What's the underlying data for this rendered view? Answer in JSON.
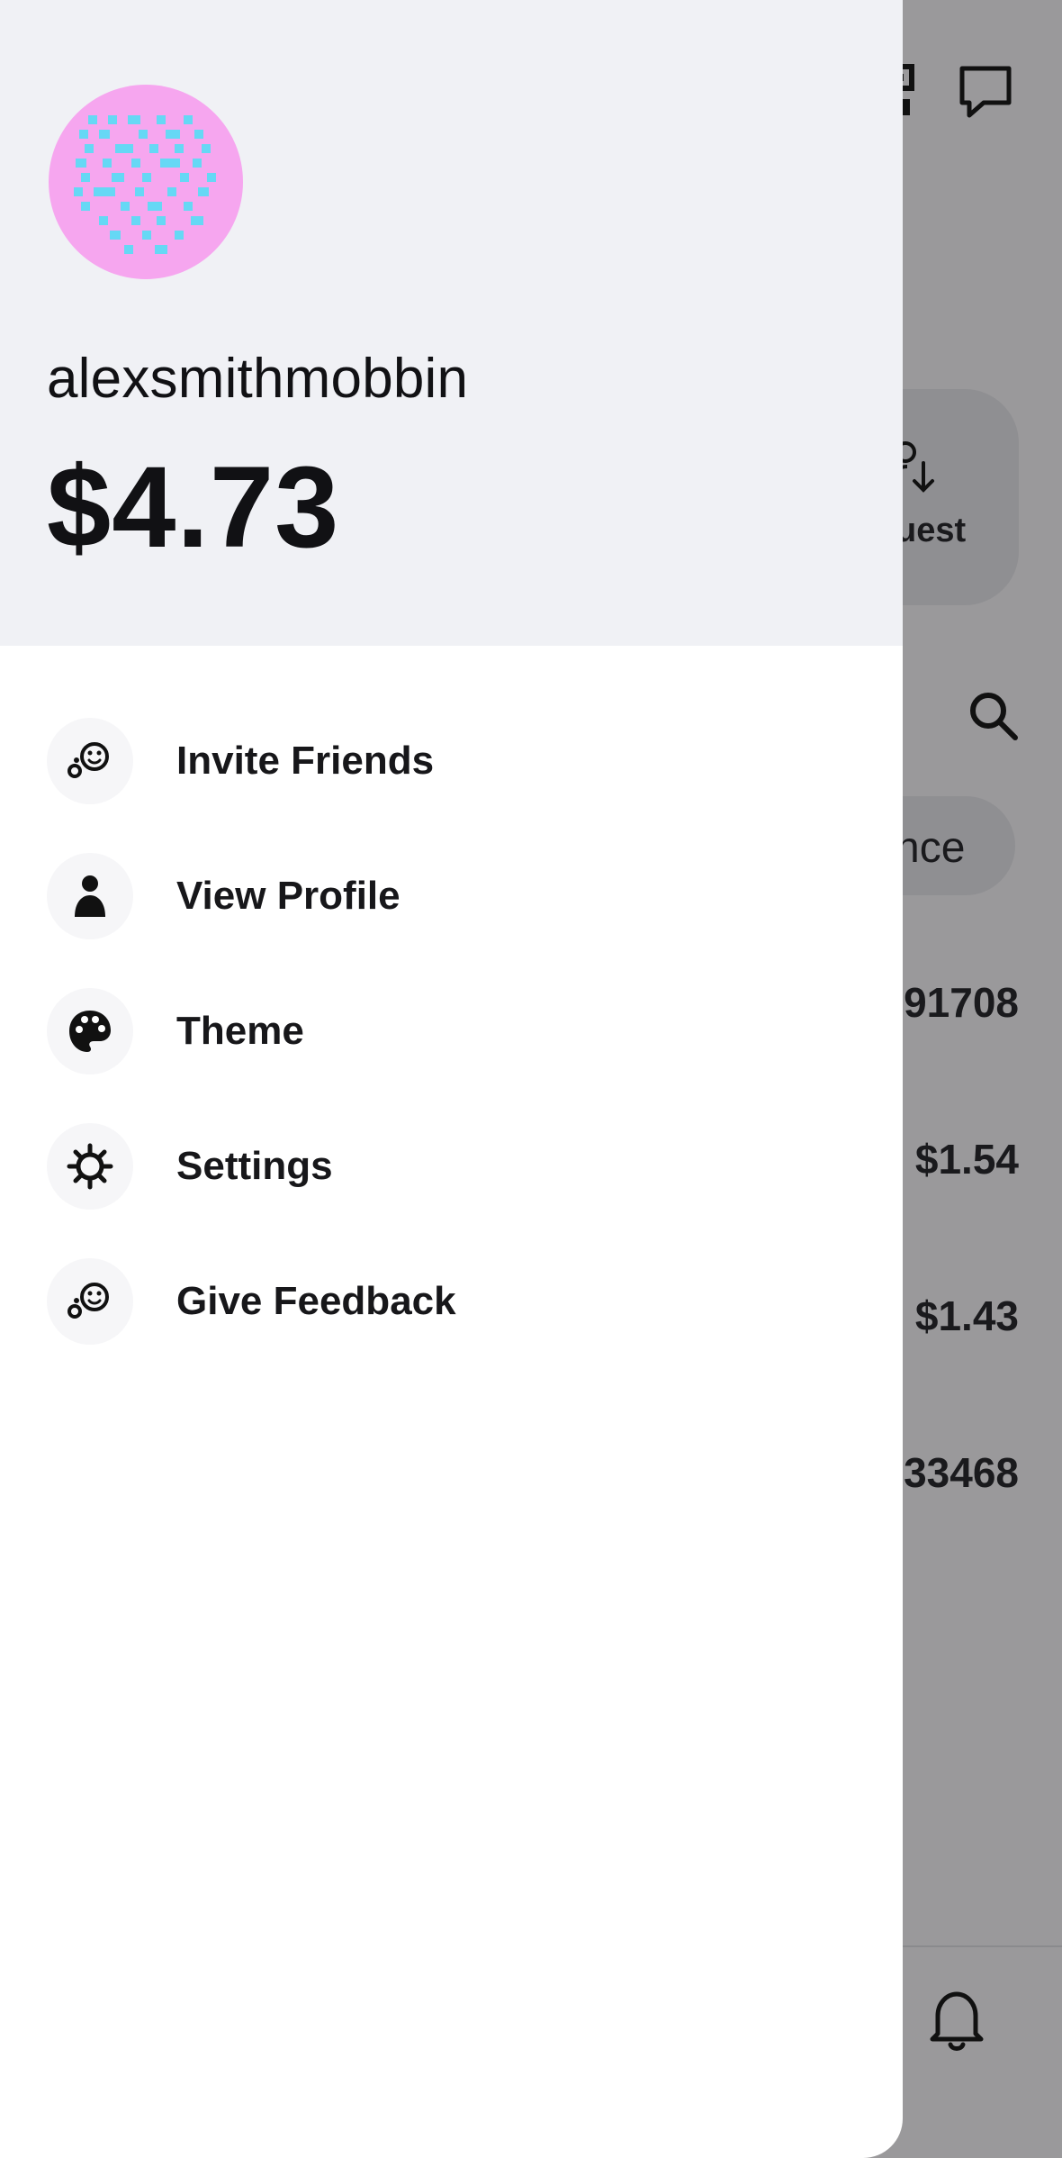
{
  "background": {
    "request_label": "uest",
    "balance_chip_label": "nce",
    "rows": [
      "91708",
      "$1.54",
      "$1.43",
      "33468"
    ]
  },
  "drawer": {
    "username": "alexsmithmobbin",
    "balance": "$4.73",
    "menu": [
      {
        "label": "Invite Friends",
        "icon": "invite-friends-icon"
      },
      {
        "label": "View Profile",
        "icon": "person-icon"
      },
      {
        "label": "Theme",
        "icon": "palette-icon"
      },
      {
        "label": "Settings",
        "icon": "gear-icon"
      },
      {
        "label": "Give Feedback",
        "icon": "feedback-icon"
      }
    ]
  },
  "colors": {
    "header_bg": "#f0f1f5",
    "avatar_bg": "#f6a6ef",
    "avatar_dots": "#66d8f5",
    "overlay_bg": "#9a999b",
    "text": "#111114"
  }
}
